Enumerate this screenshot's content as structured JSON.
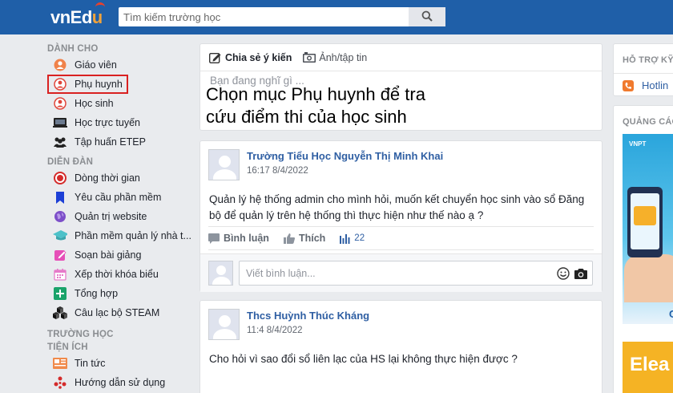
{
  "header": {
    "logo_part1": "vnEd",
    "logo_part2": "u",
    "search_placeholder": "Tìm kiếm trường học",
    "search_icon": "search-icon",
    "brand_color": "#1f5fa8"
  },
  "sidebar": {
    "section_danh_cho": "DÀNH CHO",
    "danh_cho": [
      {
        "label": "Giáo viên",
        "icon": "teacher-icon"
      },
      {
        "label": "Phụ huynh",
        "icon": "parent-icon"
      },
      {
        "label": "Học sinh",
        "icon": "student-icon"
      },
      {
        "label": "Học trực tuyến",
        "icon": "online-learning-icon"
      },
      {
        "label": "Tập huấn ETEP",
        "icon": "training-group-icon"
      }
    ],
    "section_dien_dan": "DIỄN ĐÀN",
    "dien_dan": [
      {
        "label": "Dòng thời gian",
        "icon": "timeline-icon"
      },
      {
        "label": "Yêu cầu phần mềm",
        "icon": "bookmark-icon"
      },
      {
        "label": "Quản trị website",
        "icon": "globe-icon"
      },
      {
        "label": "Phần mềm quản lý nhà t...",
        "icon": "graduation-cap-icon"
      },
      {
        "label": "Soạn bài giảng",
        "icon": "edit-icon"
      },
      {
        "label": "Xếp thời khóa biểu",
        "icon": "calendar-icon"
      },
      {
        "label": "Tổng hợp",
        "icon": "plus-box-icon"
      },
      {
        "label": "Câu lạc bộ STEAM",
        "icon": "cubes-icon"
      }
    ],
    "section_truong_hoc": "TRƯỜNG HỌC",
    "section_tien_ich": "TIỆN ÍCH",
    "tien_ich": [
      {
        "label": "Tin tức",
        "icon": "news-icon"
      },
      {
        "label": "Hướng dẫn sử dụng",
        "icon": "help-icon"
      }
    ],
    "highlight_color": "#d92121"
  },
  "composer": {
    "tab_status": "Chia sẻ ý kiến",
    "tab_photo": "Ảnh/tập tin",
    "placeholder": "Bạn đang nghĩ gì ..."
  },
  "annotation": {
    "line1": "Chọn mục Phụ huynh để tra",
    "line2": "cứu điểm thi của học sinh"
  },
  "posts": [
    {
      "author": "Trường Tiểu Học Nguyễn Thị Minh Khai",
      "time": "16:17 8/4/2022",
      "body": "Quản lý hệ thống admin cho mình hỏi, muốn kết chuyển học sinh vào sổ Đăng bộ để quản lý trên hệ thống thì thực hiện như thế nào ạ ?",
      "comment_label": "Bình luận",
      "like_label": "Thích",
      "like_count": "22",
      "comment_placeholder": "Viết bình luận..."
    },
    {
      "author": "Thcs Huỳnh Thúc Kháng",
      "time": "11:4 8/4/2022",
      "body": "Cho hỏi vì sao đổi sổ liên lạc của HS lại không thực hiện được ?"
    }
  ],
  "right": {
    "support_title": "HỖ TRỢ KỸ",
    "hotline": "Hotlin",
    "ads_title": "QUẢNG CÁO",
    "ad1_brand": "VNPT",
    "ad1_letter": "C",
    "ad2_text": "Elea"
  }
}
